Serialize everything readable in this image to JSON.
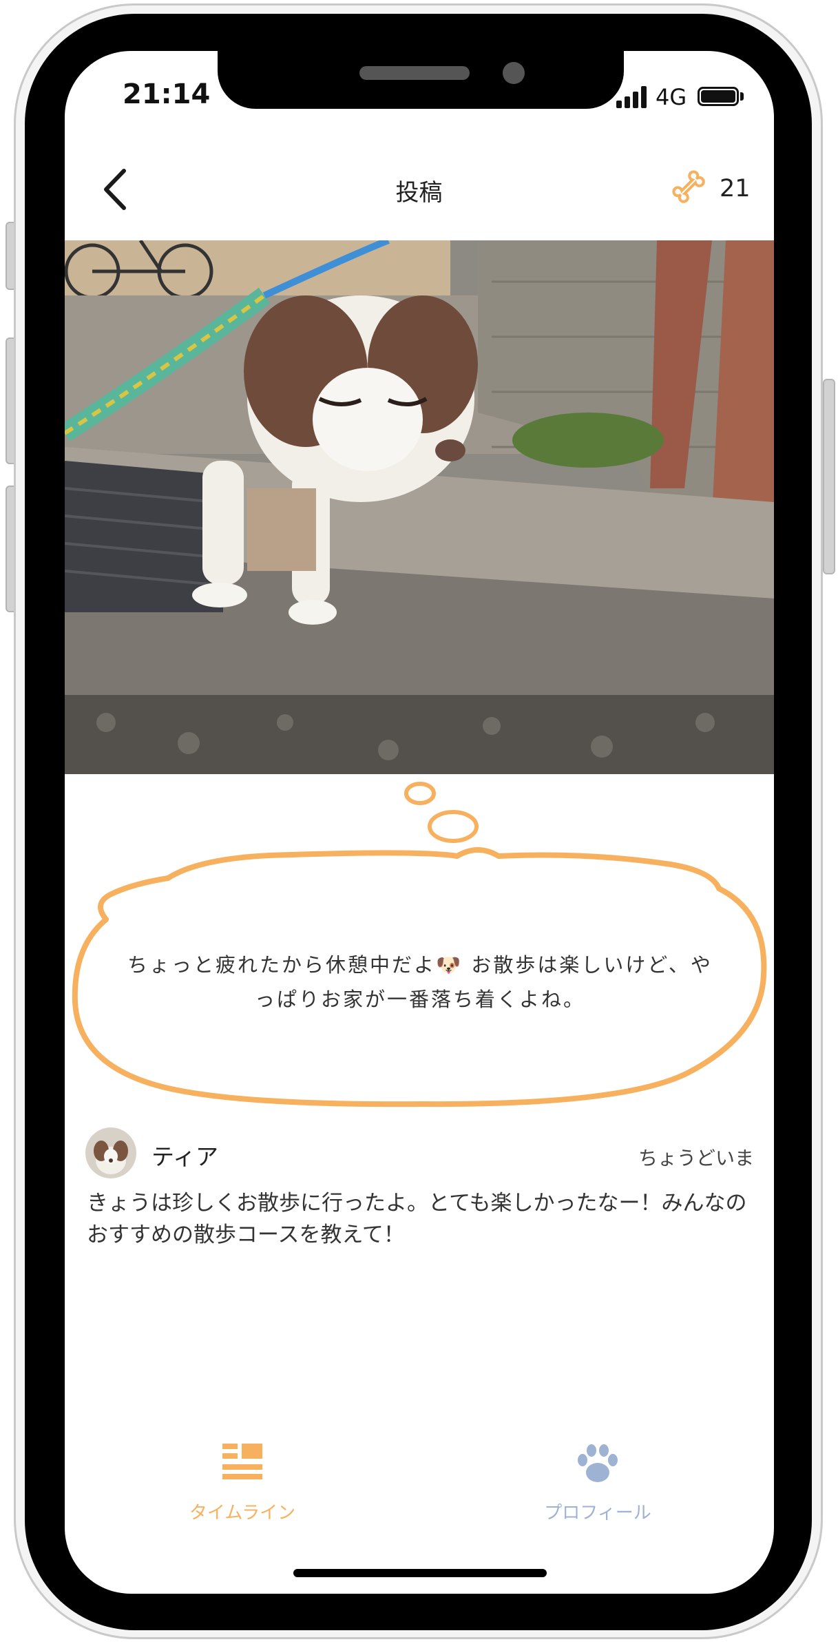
{
  "status_bar": {
    "time": "21:14",
    "network": "4G"
  },
  "header": {
    "title": "投稿",
    "bone_count": "21",
    "bone_icon": "bone-icon",
    "back_icon": "chevron-left-icon"
  },
  "photo": {
    "subject": "dog-photo"
  },
  "thought_bubble": {
    "text": "ちょっと疲れたから休憩中だよ🐶 お散歩は楽しいけど、やっぱりお家が一番落ち着くよね。"
  },
  "post": {
    "author": "ティア",
    "time_ago": "ちょうどいま",
    "body": "きょうは珍しくお散歩に行ったよ。とても楽しかったなー！みんなのおすすめの散歩コースを教えて！"
  },
  "tab_bar": {
    "tabs": [
      {
        "label": "タイムライン",
        "icon": "timeline-icon",
        "active": true
      },
      {
        "label": "プロフィール",
        "icon": "paw-icon",
        "active": false
      }
    ]
  },
  "colors": {
    "accent": "#F7B15E",
    "inactive": "#9EB2D4",
    "text": "#222222"
  }
}
